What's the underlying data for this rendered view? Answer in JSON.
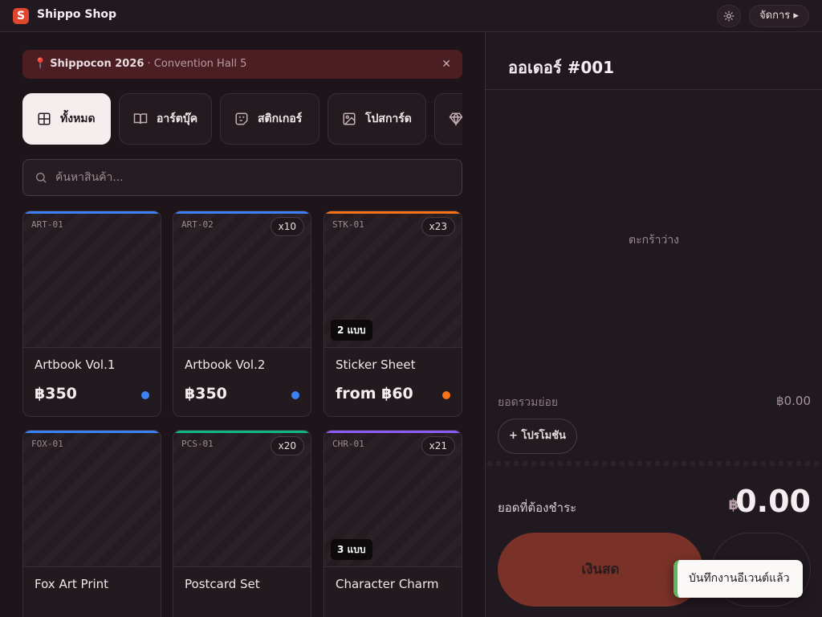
{
  "header": {
    "logo_letter": "S",
    "app_title": "Shippo Shop",
    "theme_icon": "sun-icon",
    "manage_label": "จัดการ ▸"
  },
  "event": {
    "pin_icon": "📍",
    "name": "Shippocon 2026",
    "separator": " · ",
    "location": "Convention Hall 5",
    "close_icon": "✕"
  },
  "categories": [
    {
      "label": "ทั้งหมด",
      "icon": "grid-icon",
      "active": true
    },
    {
      "label": "อาร์ตบุ๊ค",
      "icon": "book-icon",
      "active": false
    },
    {
      "label": "สติกเกอร์",
      "icon": "sticker-icon",
      "active": false
    },
    {
      "label": "โปสการ์ด",
      "icon": "image-icon",
      "active": false
    },
    {
      "label": "",
      "icon": "gem-icon",
      "active": false
    }
  ],
  "search": {
    "placeholder": "ค้นหาสินค้า..."
  },
  "products": [
    {
      "code": "ART-01",
      "name": "Artbook Vol.1",
      "price": "฿350",
      "qty": "",
      "variants": "",
      "color": "#3b82f6"
    },
    {
      "code": "ART-02",
      "name": "Artbook Vol.2",
      "price": "฿350",
      "qty": "x10",
      "variants": "",
      "color": "#3b82f6"
    },
    {
      "code": "STK-01",
      "name": "Sticker Sheet",
      "price": "from ฿60",
      "qty": "x23",
      "variants": "2 แบบ",
      "color": "#f97316"
    },
    {
      "code": "FOX-01",
      "name": "Fox Art Print",
      "price": "",
      "qty": "",
      "variants": "",
      "color": "#3b82f6"
    },
    {
      "code": "PCS-01",
      "name": "Postcard Set",
      "price": "",
      "qty": "x20",
      "variants": "",
      "color": "#10b981"
    },
    {
      "code": "CHR-01",
      "name": "Character Charm",
      "price": "",
      "qty": "x21",
      "variants": "3 แบบ",
      "color": "#8b5cf6"
    }
  ],
  "order": {
    "title": "ออเดอร์ #001",
    "empty_text": "ตะกร้าว่าง",
    "subtotal_label": "ยอดรวมย่อย",
    "subtotal_value": "฿0.00",
    "promo_label": "+ โปรโมชัน",
    "total_label": "ยอดที่ต้องชำระ",
    "total_currency": "฿",
    "total_value": "0.00",
    "cash_label": "เงินสด"
  },
  "toast": {
    "message": "บันทึกงานอีเวนต์แล้ว"
  }
}
